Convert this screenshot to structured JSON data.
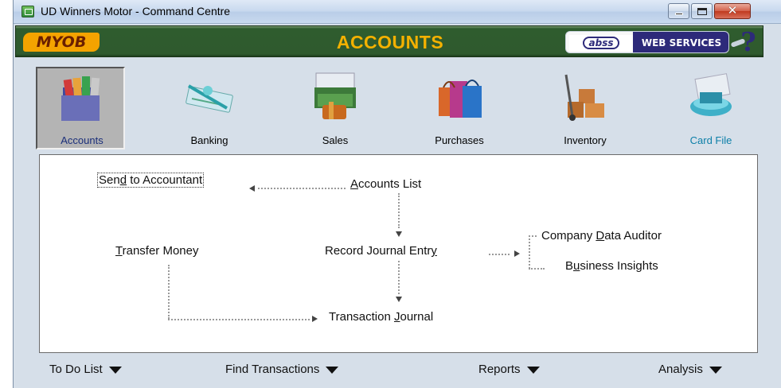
{
  "window": {
    "title": "UD Winners Motor - Command Centre"
  },
  "header": {
    "brand": "MYOB",
    "title": "ACCOUNTS",
    "abss_logo": "abss",
    "web_services": "WEB SERVICES",
    "help": "?"
  },
  "modules": [
    {
      "label": "Accounts",
      "selected": true
    },
    {
      "label": "Banking"
    },
    {
      "label": "Sales"
    },
    {
      "label": "Purchases"
    },
    {
      "label": "Inventory"
    },
    {
      "label": "Card File"
    }
  ],
  "links": {
    "send_to_accountant": {
      "pre": "Sen",
      "u": "d",
      "post": " to Accountant"
    },
    "accounts_list": {
      "pre": "",
      "u": "A",
      "post": "ccounts List"
    },
    "transfer_money": {
      "pre": "",
      "u": "T",
      "post": "ransfer Money"
    },
    "record_journal_entry": {
      "pre": "Record Journal Entr",
      "u": "y",
      "post": ""
    },
    "company_data_auditor": {
      "pre": "Company ",
      "u": "D",
      "post": "ata Auditor"
    },
    "business_insights": {
      "pre": "B",
      "u": "u",
      "post": "siness Insights"
    },
    "transaction_journal": {
      "pre": "Transaction ",
      "u": "J",
      "post": "ournal"
    }
  },
  "bottom": {
    "todo": "To Do List",
    "find": "Find Transactions",
    "reports": "Reports",
    "analysis": "Analysis"
  },
  "colors": {
    "header_green": "#2f5c2e",
    "myob_orange": "#f4a300",
    "title_gold": "#f4b100",
    "abss_navy": "#2d2a7a"
  }
}
